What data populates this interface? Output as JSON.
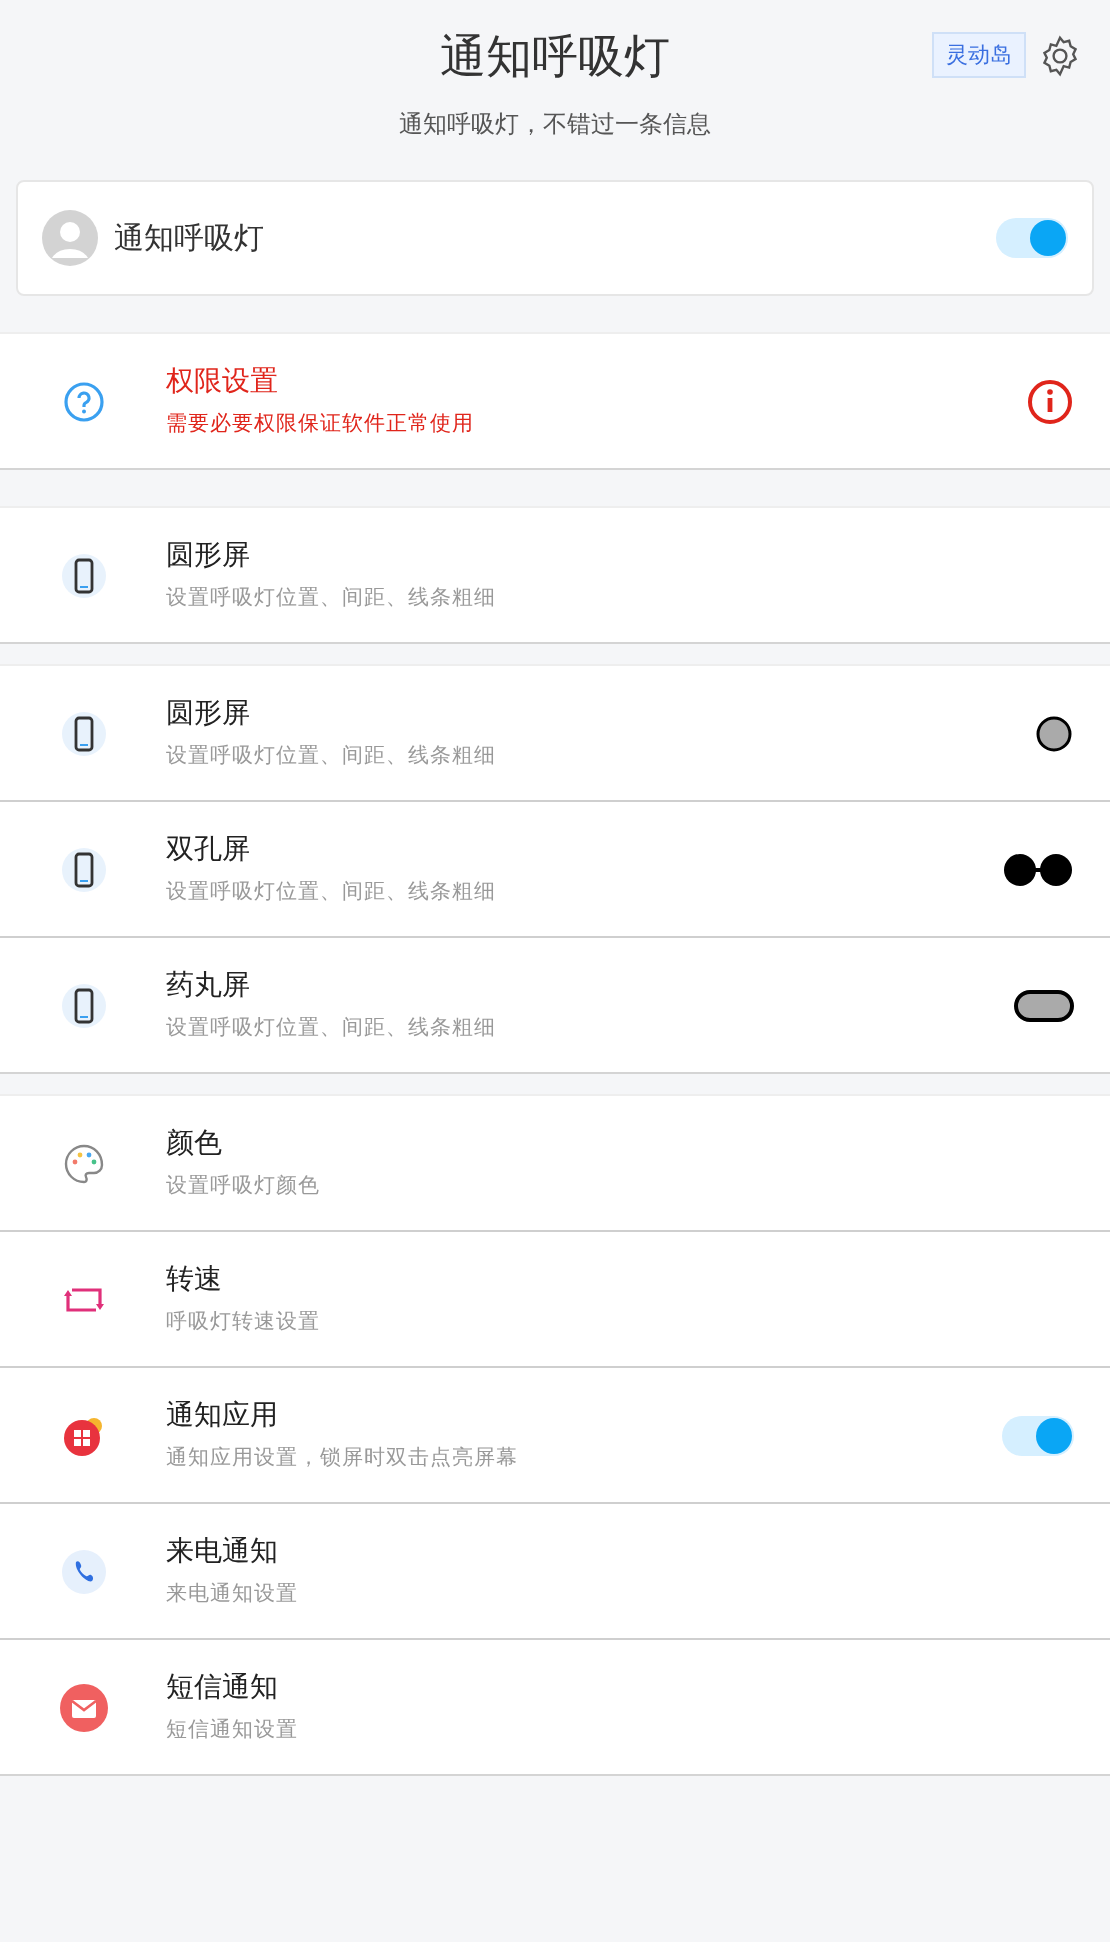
{
  "header": {
    "title": "通知呼吸灯",
    "subtitle": "通知呼吸灯，不错过一条信息",
    "badge": "灵动岛"
  },
  "master": {
    "label": "通知呼吸灯",
    "on": true
  },
  "groups": [
    {
      "rows": [
        {
          "kind": "info",
          "title": "权限设置",
          "subtitle": "需要必要权限保证软件正常使用",
          "alert": true
        }
      ]
    },
    {
      "rows": [
        {
          "kind": "plain",
          "title": "圆形屏",
          "subtitle": "设置呼吸灯位置、间距、线条粗细",
          "alert": false
        }
      ]
    },
    {
      "rows": [
        {
          "kind": "circle",
          "title": "圆形屏",
          "subtitle": "设置呼吸灯位置、间距、线条粗细",
          "alert": false
        },
        {
          "kind": "dual",
          "title": "双孔屏",
          "subtitle": "设置呼吸灯位置、间距、线条粗细",
          "alert": false
        },
        {
          "kind": "pill",
          "title": "药丸屏",
          "subtitle": "设置呼吸灯位置、间距、线条粗细",
          "alert": false
        }
      ]
    },
    {
      "rows": [
        {
          "kind": "plain",
          "title": "颜色",
          "subtitle": "设置呼吸灯颜色",
          "alert": false
        },
        {
          "kind": "plain",
          "title": "转速",
          "subtitle": "呼吸灯转速设置",
          "alert": false
        },
        {
          "kind": "toggle",
          "title": "通知应用",
          "subtitle": "通知应用设置，锁屏时双击点亮屏幕",
          "alert": false,
          "on": true
        },
        {
          "kind": "plain",
          "title": "来电通知",
          "subtitle": "来电通知设置",
          "alert": false
        },
        {
          "kind": "plain",
          "title": "短信通知",
          "subtitle": "短信通知设置",
          "alert": false
        }
      ]
    }
  ]
}
